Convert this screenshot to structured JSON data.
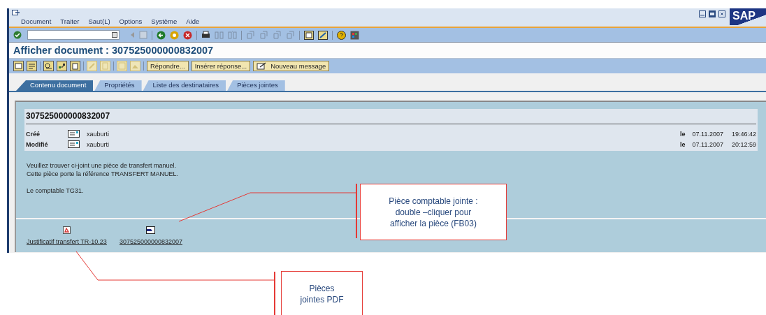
{
  "menu": [
    "Document",
    "Traiter",
    "Saut(L)",
    "Options",
    "Système",
    "Aide"
  ],
  "logo": "SAP",
  "title": "Afficher document : 307525000000832007",
  "app_buttons": [
    "Répondre...",
    "Insérer réponse...",
    "Nouveau message"
  ],
  "tabs": [
    {
      "label": "Contenu document",
      "selected": true
    },
    {
      "label": "Propriétés",
      "selected": false
    },
    {
      "label": "Liste des destinataires",
      "selected": false
    },
    {
      "label": "Pièces jointes",
      "selected": false
    }
  ],
  "document": {
    "heading": "307525000000832007",
    "fields": [
      {
        "label": "Créé",
        "user": "xauburti",
        "prefix": "le",
        "date": "07.11.2007",
        "time": "19:46:42"
      },
      {
        "label": "Modifié",
        "user": "xauburti",
        "prefix": "le",
        "date": "07.11.2007",
        "time": "20:12:59"
      }
    ],
    "body_paragraphs": [
      [
        "Veuillez trouver ci-joint une pièce de transfert manuel.",
        "Cette pièce porte la référence TRANSFERT MANUEL."
      ],
      [
        "Le comptable TG31."
      ]
    ],
    "attachments": [
      {
        "kind": "pdf",
        "name": "Justificatif transfert TR-10.23"
      },
      {
        "kind": "document",
        "name": "307525000000832007"
      }
    ]
  },
  "callouts": [
    {
      "lines": [
        "Pièce comptable jointe :",
        "double –cliquer pour",
        "afficher la pièce (FB03)"
      ]
    },
    {
      "lines": [
        "Pièces",
        "jointes PDF"
      ]
    }
  ]
}
